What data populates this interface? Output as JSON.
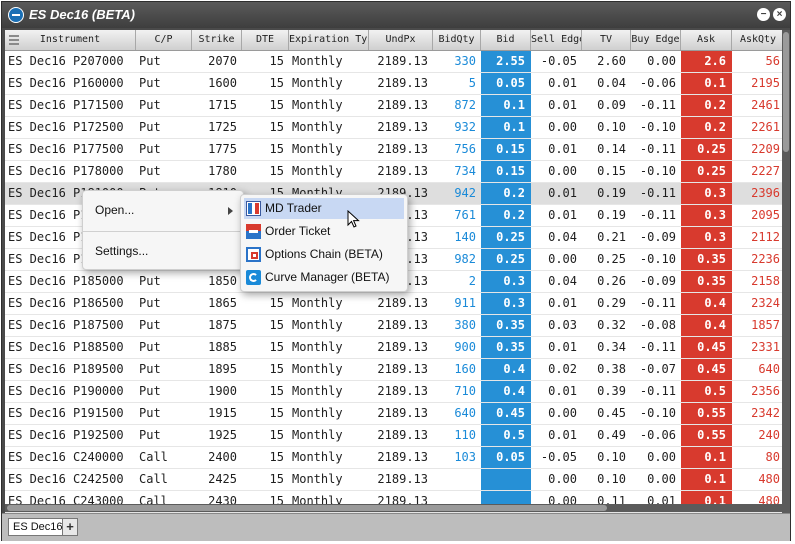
{
  "window": {
    "title": "ES Dec16 (BETA)"
  },
  "columns": [
    "Instrument",
    "C/P",
    "Strike",
    "DTE",
    "Expiration Typ",
    "UndPx",
    "BidQty",
    "Bid",
    "Sell Edge",
    "TV",
    "Buy Edge",
    "Ask",
    "AskQty"
  ],
  "rows": [
    [
      "ES Dec16 P207000",
      "Put",
      "2070",
      "15",
      "Monthly",
      "2189.13",
      "330",
      "2.55",
      "-0.05",
      "2.60",
      "0.00",
      "2.6",
      "56"
    ],
    [
      "ES Dec16 P160000",
      "Put",
      "1600",
      "15",
      "Monthly",
      "2189.13",
      "5",
      "0.05",
      "0.01",
      "0.04",
      "-0.06",
      "0.1",
      "2195"
    ],
    [
      "ES Dec16 P171500",
      "Put",
      "1715",
      "15",
      "Monthly",
      "2189.13",
      "872",
      "0.1",
      "0.01",
      "0.09",
      "-0.11",
      "0.2",
      "2461"
    ],
    [
      "ES Dec16 P172500",
      "Put",
      "1725",
      "15",
      "Monthly",
      "2189.13",
      "932",
      "0.1",
      "0.00",
      "0.10",
      "-0.10",
      "0.2",
      "2261"
    ],
    [
      "ES Dec16 P177500",
      "Put",
      "1775",
      "15",
      "Monthly",
      "2189.13",
      "756",
      "0.15",
      "0.01",
      "0.14",
      "-0.11",
      "0.25",
      "2209"
    ],
    [
      "ES Dec16 P178000",
      "Put",
      "1780",
      "15",
      "Monthly",
      "2189.13",
      "734",
      "0.15",
      "0.00",
      "0.15",
      "-0.10",
      "0.25",
      "2227"
    ],
    [
      "ES Dec16 P181000",
      "Put",
      "1810",
      "15",
      "Monthly",
      "2189.13",
      "942",
      "0.2",
      "0.01",
      "0.19",
      "-0.11",
      "0.3",
      "2396"
    ],
    [
      "ES Dec16 P182000",
      "Put",
      "1820",
      "15",
      "Monthly",
      "2189.13",
      "761",
      "0.2",
      "0.01",
      "0.19",
      "-0.11",
      "0.3",
      "2095"
    ],
    [
      "ES Dec16 P183000",
      "Put",
      "1830",
      "15",
      "Monthly",
      "2189.13",
      "140",
      "0.25",
      "0.04",
      "0.21",
      "-0.09",
      "0.3",
      "2112"
    ],
    [
      "ES Dec16 P184000",
      "Put",
      "1840",
      "15",
      "Monthly",
      "2189.13",
      "982",
      "0.25",
      "0.00",
      "0.25",
      "-0.10",
      "0.35",
      "2236"
    ],
    [
      "ES Dec16 P185000",
      "Put",
      "1850",
      "15",
      "Monthly",
      "2189.13",
      "2",
      "0.3",
      "0.04",
      "0.26",
      "-0.09",
      "0.35",
      "2158"
    ],
    [
      "ES Dec16 P186500",
      "Put",
      "1865",
      "15",
      "Monthly",
      "2189.13",
      "911",
      "0.3",
      "0.01",
      "0.29",
      "-0.11",
      "0.4",
      "2324"
    ],
    [
      "ES Dec16 P187500",
      "Put",
      "1875",
      "15",
      "Monthly",
      "2189.13",
      "380",
      "0.35",
      "0.03",
      "0.32",
      "-0.08",
      "0.4",
      "1857"
    ],
    [
      "ES Dec16 P188500",
      "Put",
      "1885",
      "15",
      "Monthly",
      "2189.13",
      "900",
      "0.35",
      "0.01",
      "0.34",
      "-0.11",
      "0.45",
      "2331"
    ],
    [
      "ES Dec16 P189500",
      "Put",
      "1895",
      "15",
      "Monthly",
      "2189.13",
      "160",
      "0.4",
      "0.02",
      "0.38",
      "-0.07",
      "0.45",
      "640"
    ],
    [
      "ES Dec16 P190000",
      "Put",
      "1900",
      "15",
      "Monthly",
      "2189.13",
      "710",
      "0.4",
      "0.01",
      "0.39",
      "-0.11",
      "0.5",
      "2356"
    ],
    [
      "ES Dec16 P191500",
      "Put",
      "1915",
      "15",
      "Monthly",
      "2189.13",
      "640",
      "0.45",
      "0.00",
      "0.45",
      "-0.10",
      "0.55",
      "2342"
    ],
    [
      "ES Dec16 P192500",
      "Put",
      "1925",
      "15",
      "Monthly",
      "2189.13",
      "110",
      "0.5",
      "0.01",
      "0.49",
      "-0.06",
      "0.55",
      "240"
    ],
    [
      "ES Dec16 C240000",
      "Call",
      "2400",
      "15",
      "Monthly",
      "2189.13",
      "103",
      "0.05",
      "-0.05",
      "0.10",
      "0.00",
      "0.1",
      "80"
    ],
    [
      "ES Dec16 C242500",
      "Call",
      "2425",
      "15",
      "Monthly",
      "2189.13",
      "",
      "",
      "0.00",
      "0.10",
      "0.00",
      "0.1",
      "480"
    ],
    [
      "ES Dec16 C243000",
      "Call",
      "2430",
      "15",
      "Monthly",
      "2189.13",
      "",
      "",
      "0.00",
      "0.11",
      "0.01",
      "0.1",
      "480"
    ]
  ],
  "selected_row": 6,
  "context_menu": {
    "open_label": "Open...",
    "settings_label": "Settings..."
  },
  "submenu": [
    {
      "label": "MD Trader",
      "icon": "md-trader-icon"
    },
    {
      "label": "Order Ticket",
      "icon": "order-ticket-icon"
    },
    {
      "label": "Options Chain (BETA)",
      "icon": "options-chain-icon"
    },
    {
      "label": "Curve Manager (BETA)",
      "icon": "curve-manager-icon"
    }
  ],
  "tabs": {
    "active": "ES Dec16",
    "add": "+"
  },
  "colors": {
    "bid": "#2690d6",
    "ask": "#d83a2e",
    "bidqty": "#1a8ad8",
    "askqty": "#d83a2e"
  }
}
